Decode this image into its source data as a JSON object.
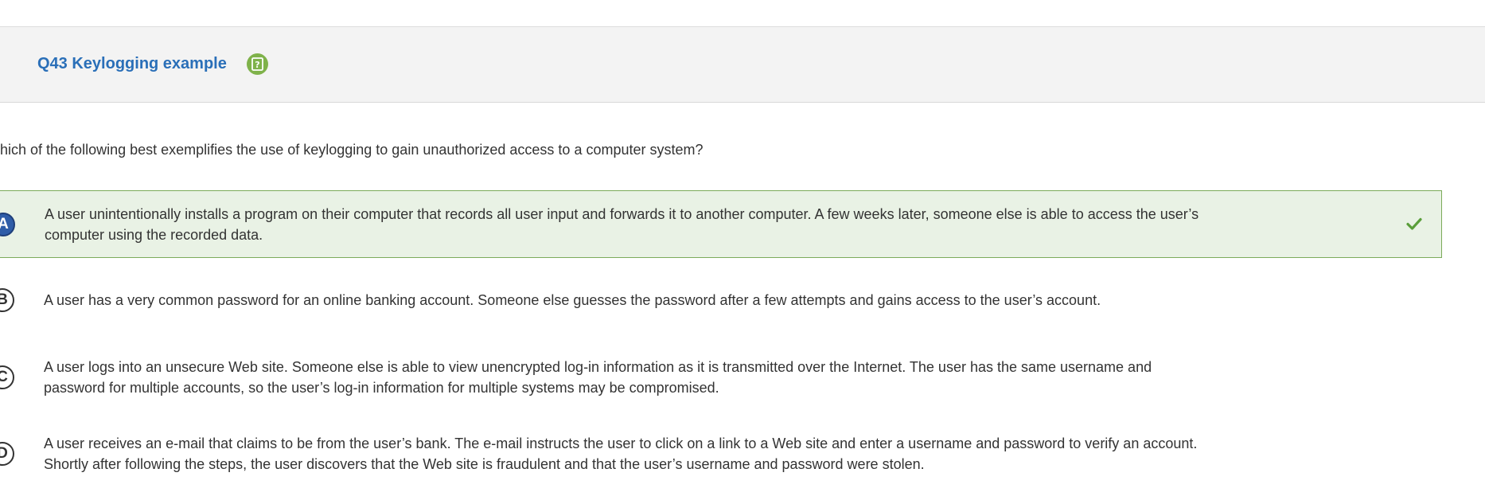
{
  "question": {
    "title": "Q43 Keylogging example",
    "help_icon": "question-help-icon",
    "prompt": "hich of the following best exemplifies the use of keylogging to gain unauthorized access to a computer system?"
  },
  "options": [
    {
      "letter": "A",
      "text": "A user unintentionally installs a program on their computer that records all user input and forwards it to another computer. A few weeks later, someone else is able to access the user’s computer using the recorded data.",
      "selected": true,
      "correct": true
    },
    {
      "letter": "B",
      "text": "A user has a very common password for an online banking account. Someone else guesses the password after a few attempts and gains access to the user’s account.",
      "selected": false,
      "correct": false
    },
    {
      "letter": "C",
      "text": "A user logs into an unsecure Web site. Someone else is able to view unencrypted log-in information as it is transmitted over the Internet. The user has the same username and password for multiple accounts, so the user’s log-in information for multiple systems may be compromised.",
      "selected": false,
      "correct": false
    },
    {
      "letter": "D",
      "text": "A user receives an e-mail that claims to be from the user’s bank. The e-mail instructs the user to click on a link to a Web site and enter a username and password to verify an account. Shortly after following the steps, the user discovers that the Web site is fraudulent and that the user’s username and password were stolen.",
      "selected": false,
      "correct": false
    }
  ],
  "colors": {
    "title": "#2a6fb8",
    "help_icon": "#7fb24a",
    "correct_bg": "#e9f2e5",
    "correct_border": "#7bab5a",
    "selected_letter": "#2f5da8",
    "check": "#5a9e3a"
  }
}
